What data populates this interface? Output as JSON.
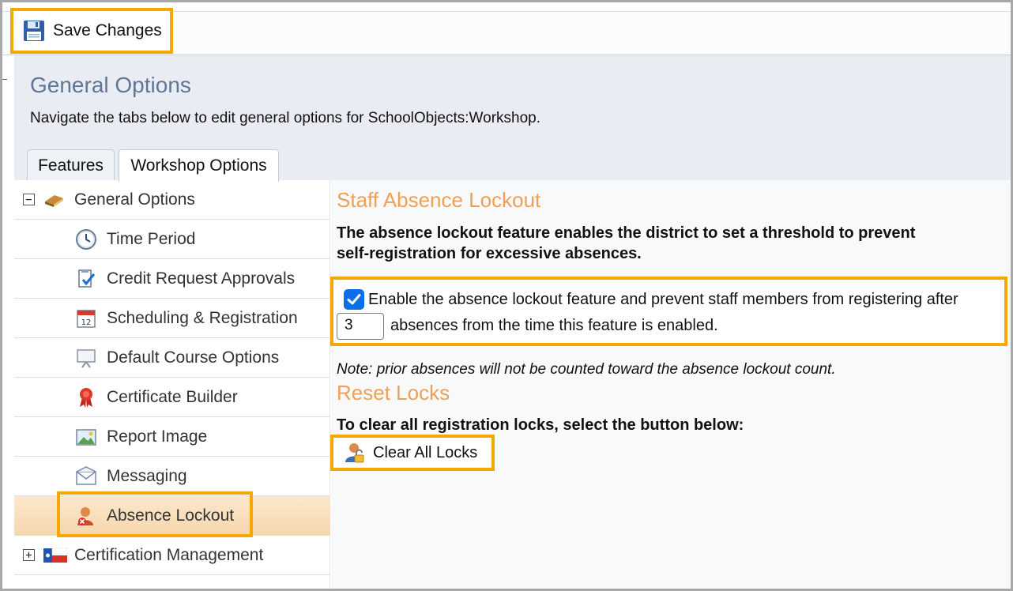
{
  "toolbar": {
    "save_label": "Save Changes"
  },
  "header": {
    "title": "General Options",
    "description": "Navigate the tabs below to edit general options for SchoolObjects:Workshop."
  },
  "tabs": [
    {
      "label": "Features",
      "active": false
    },
    {
      "label": "Workshop Options",
      "active": true
    }
  ],
  "tree": {
    "parent": {
      "label": "General Options",
      "expander": "−"
    },
    "children": [
      {
        "label": "Time Period",
        "icon": "clock-icon"
      },
      {
        "label": "Credit Request Approvals",
        "icon": "approval-icon"
      },
      {
        "label": "Scheduling & Registration",
        "icon": "calendar-icon"
      },
      {
        "label": "Default Course Options",
        "icon": "presentation-icon"
      },
      {
        "label": "Certificate Builder",
        "icon": "ribbon-icon"
      },
      {
        "label": "Report Image",
        "icon": "image-icon"
      },
      {
        "label": "Messaging",
        "icon": "envelope-icon"
      },
      {
        "label": "Absence Lockout",
        "icon": "user-lock-icon",
        "selected": true
      }
    ],
    "sibling": {
      "label": "Certification Management",
      "expander": "+"
    }
  },
  "panel": {
    "lockout_title": "Staff Absence Lockout",
    "lockout_desc": "The absence lockout feature enables the district to set a threshold to prevent self-registration for excessive absences.",
    "lockout_desc_line1": "The absence lockout feature enables the district to set a threshold to prevent",
    "lockout_desc_line2": "self-registration for excessive absences.",
    "checkbox_checked": true,
    "checkbox_text": "Enable the absence lockout feature and prevent staff members from registering after",
    "absence_count": "3",
    "after_input_text": "absences from the time this feature is enabled.",
    "note": "Note: prior absences will not be counted toward the absence lockout count.",
    "reset_title": "Reset Locks",
    "reset_desc": "To clear all registration locks, select the button below:",
    "clear_label": "Clear All Locks"
  },
  "colors": {
    "highlight": "#f5a800",
    "section_title": "#f0a055",
    "page_title": "#5f7696",
    "checkbox": "#0a6fe8"
  }
}
